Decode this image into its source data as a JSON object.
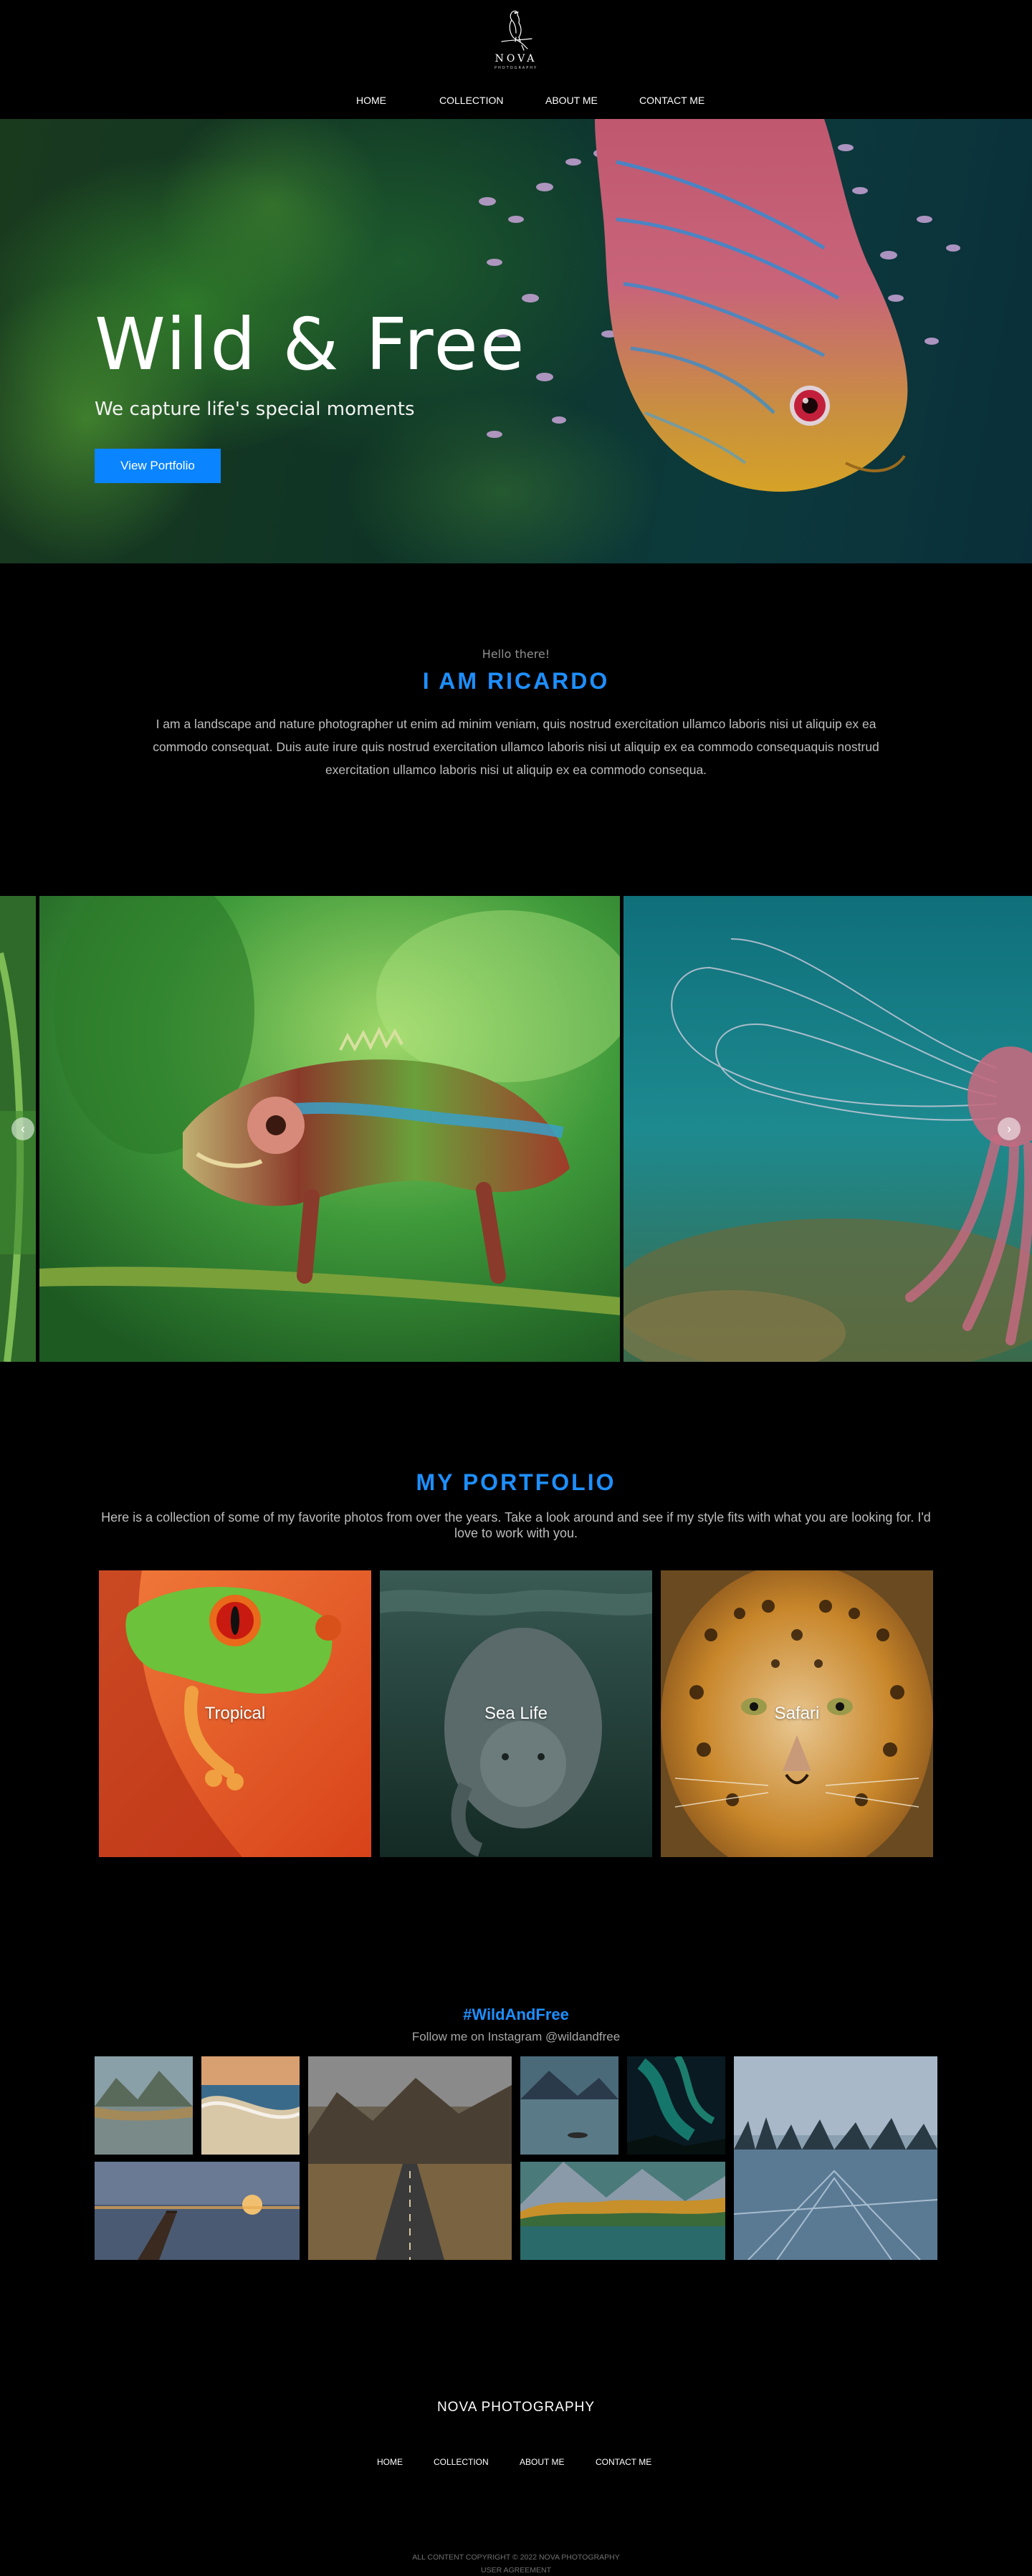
{
  "brand": {
    "logo_name": "NOVA",
    "logo_sub": "PHOTOGRAPHY",
    "logo_icon": "bird-icon"
  },
  "nav": {
    "items": [
      {
        "label": "HOME"
      },
      {
        "label": "COLLECTION"
      },
      {
        "label": "ABOUT ME"
      },
      {
        "label": "CONTACT ME"
      }
    ]
  },
  "hero": {
    "title": "Wild & Free",
    "subtitle": "We capture life's special moments",
    "button_label": "View Portfolio",
    "button_color": "#0a84ff"
  },
  "about": {
    "greeting": "Hello there!",
    "heading": "I AM RICARDO",
    "body": "I am a landscape and nature photographer ut enim ad minim veniam, quis nostrud exercitation ullamco laboris nisi ut aliquip ex ea commodo consequat. Duis aute irure quis nostrud exercitation ullamco laboris nisi ut aliquip ex ea commodo consequaquis nostrud exercitation ullamco laboris nisi ut aliquip ex ea commodo consequa."
  },
  "carousel": {
    "prev_icon": "chevron-left-icon",
    "next_icon": "chevron-right-icon",
    "prev_glyph": "‹",
    "next_glyph": "›"
  },
  "portfolio": {
    "heading": "MY PORTFOLIO",
    "intro": "Here is a collection of some of my favorite photos from over the years. Take a look around and see if my style fits with what you are looking for. I'd love to work with you.",
    "cards": [
      {
        "label": "Tropical"
      },
      {
        "label": "Sea Life"
      },
      {
        "label": "Safari"
      }
    ]
  },
  "instagram": {
    "hashtag": "#WildAndFree",
    "follow": "Follow me on Instagram @wildandfree"
  },
  "footer": {
    "brand": "NOVA PHOTOGRAPHY",
    "nav": [
      {
        "label": "HOME"
      },
      {
        "label": "COLLECTION"
      },
      {
        "label": "ABOUT ME"
      },
      {
        "label": "CONTACT ME"
      }
    ],
    "copyright": "ALL CONTENT COPYRIGHT © 2022 NOVA PHOTOGRAPHY",
    "legal": "USER AGREEMENT"
  },
  "colors": {
    "accent": "#1e8fff",
    "background": "#000000",
    "body_text": "#bdbdbd"
  }
}
